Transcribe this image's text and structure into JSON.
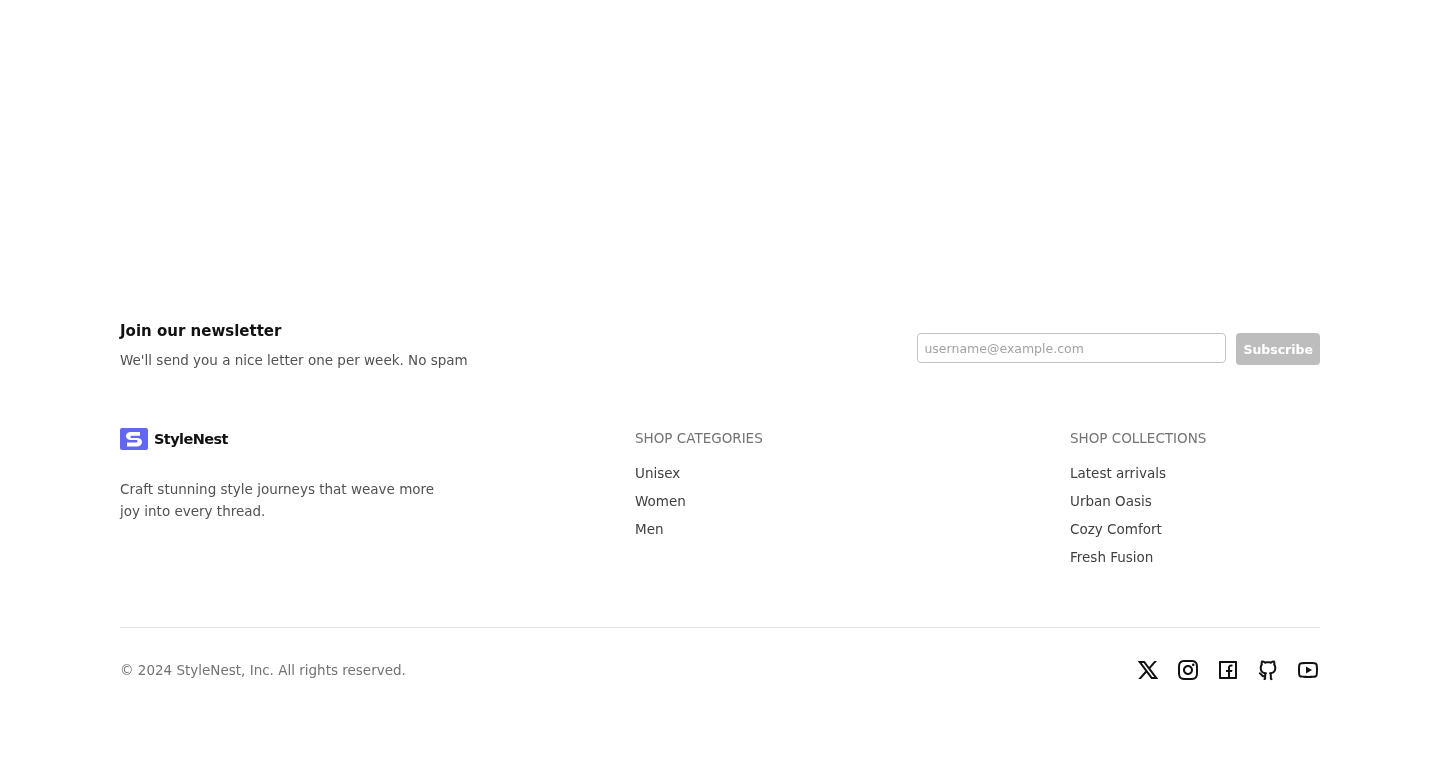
{
  "newsletter": {
    "title": "Join our newsletter",
    "description": "We'll send you a nice letter one per week. No spam",
    "email_field": {
      "placeholder": "username@example.com"
    },
    "subscribe_button": {
      "label": "Subscribe",
      "disabled": true
    }
  },
  "brand": {
    "name": "StyleNest",
    "tagline": "Craft stunning style journeys that weave more joy into every thread."
  },
  "link_groups": [
    {
      "heading": "SHOP CATEGORIES",
      "links": [
        "Unisex",
        "Women",
        "Men"
      ]
    },
    {
      "heading": "SHOP COLLECTIONS",
      "links": [
        "Latest arrivals",
        "Urban Oasis",
        "Cozy Comfort",
        "Fresh Fusion"
      ]
    }
  ],
  "copyright": "© 2024 StyleNest, Inc. All rights reserved.",
  "social_links": [
    {
      "kind": "x"
    },
    {
      "kind": "instagram"
    },
    {
      "kind": "facebook"
    },
    {
      "kind": "github"
    },
    {
      "kind": "youtube"
    }
  ]
}
